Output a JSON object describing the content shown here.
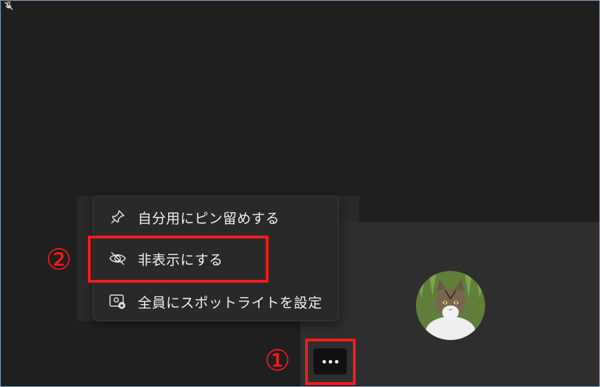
{
  "menu": {
    "items": [
      {
        "label": "自分用にピン留めする",
        "icon": "pin-icon"
      },
      {
        "label": "非表示にする",
        "icon": "eye-off-icon"
      },
      {
        "label": "全員にスポットライトを設定",
        "icon": "spotlight-icon"
      }
    ]
  },
  "more_button": {
    "icon": "more-options-icon"
  },
  "callouts": {
    "step1": "①",
    "step2": "②"
  },
  "colors": {
    "background": "#1f1f1f",
    "menu_background": "#292929",
    "tile_background": "#2e2e2e",
    "annotation_red": "#ff1a1a",
    "text": "#f0f0f0"
  },
  "icons": {
    "mic": "mic-off-icon",
    "avatar": "participant-avatar-cat"
  }
}
